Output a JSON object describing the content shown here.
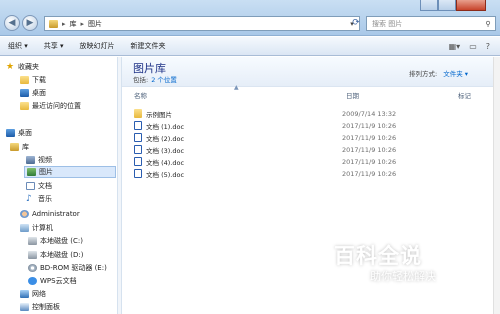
{
  "address": {
    "crumbs": [
      "库",
      "图片"
    ]
  },
  "search": {
    "placeholder": "搜索 图片"
  },
  "toolbar": {
    "organize": "组织 ▾",
    "share": "共享 ▾",
    "slideshow": "放映幻灯片",
    "new_folder": "新建文件夹"
  },
  "sidebar": {
    "favorites": "收藏夹",
    "downloads": "下载",
    "desktop_fav": "桌面",
    "recent": "最近访问的位置",
    "desktop": "桌面",
    "libraries": "库",
    "videos": "视频",
    "pictures": "图片",
    "documents": "文档",
    "music": "音乐",
    "admin": "Administrator",
    "computer": "计算机",
    "drive_c": "本地磁盘 (C:)",
    "drive_d": "本地磁盘 (D:)",
    "drive_e": "BD-ROM 驱动器 (E:)",
    "wps": "WPS云文档",
    "network": "网络",
    "control_panel": "控制面板"
  },
  "library": {
    "title": "图片库",
    "includes_label": "包括:",
    "includes_link": "2 个位置",
    "arrange_label": "排列方式:",
    "arrange_value": "文件夹 ▾"
  },
  "columns": {
    "name": "名称",
    "date": "日期",
    "tags": "标记"
  },
  "files": [
    {
      "name": "示例图片",
      "date": "2009/7/14 13:32",
      "type": "folder"
    },
    {
      "name": "文档 (1).doc",
      "date": "2017/11/9 10:26",
      "type": "doc"
    },
    {
      "name": "文档 (2).doc",
      "date": "2017/11/9 10:26",
      "type": "doc"
    },
    {
      "name": "文档 (3).doc",
      "date": "2017/11/9 10:26",
      "type": "doc"
    },
    {
      "name": "文档 (4).doc",
      "date": "2017/11/9 10:26",
      "type": "doc"
    },
    {
      "name": "文档 (5).doc",
      "date": "2017/11/9 10:26",
      "type": "doc"
    }
  ],
  "watermark": {
    "main": "百科全说",
    "sub": "助你轻松解决"
  }
}
